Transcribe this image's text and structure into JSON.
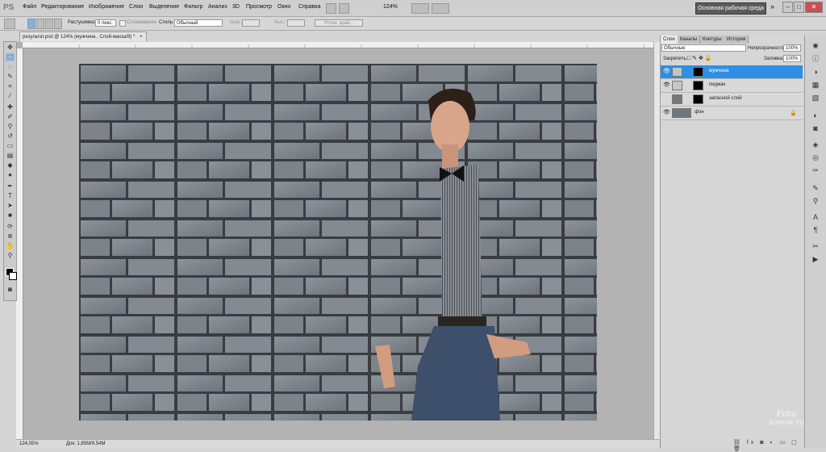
{
  "app": {
    "logo": "PS"
  },
  "menu": [
    "Файл",
    "Редактирование",
    "Изображение",
    "Слои",
    "Выделение",
    "Фильтр",
    "Анализ",
    "3D",
    "Просмотр",
    "Окно",
    "Справка"
  ],
  "zoom_menu": "124%",
  "workspace": "Основная рабочая среда",
  "window_controls": {
    "more": "»",
    "min": "–",
    "max": "□",
    "close": "✕"
  },
  "options": {
    "feather_label": "Растушевка:",
    "feather_value": "0 пикс.",
    "antialias_label": "Сглаживание",
    "style_label": "Стиль:",
    "style_value": "Обычный",
    "width_label": "Шир.:",
    "height_label": "Выс.:",
    "refine_edge": "Уточн. край..."
  },
  "document": {
    "tab_title": "результат.psd @ 124% (мужчина , Слой-маска/8) *",
    "close": "×",
    "status_zoom": "124,05%",
    "status_doc": "Док: 1,85M/9,54M"
  },
  "panel": {
    "tabs": [
      "Слои",
      "Каналы",
      "Контуры",
      "История"
    ],
    "blend_mode": "Обычные",
    "opacity_label": "Непрозрачность:",
    "opacity_value": "100%",
    "lock_label": "Закрепить:",
    "fill_label": "Заливка:",
    "fill_value": "100%",
    "layers": [
      {
        "name": "мужчина",
        "selected": true
      },
      {
        "name": "пиджак",
        "selected": false
      },
      {
        "name": "запасной слой",
        "selected": false
      },
      {
        "name": "фон",
        "selected": false
      }
    ]
  },
  "watermark": {
    "line1": "Foto",
    "line2": "komok.ru"
  },
  "icons": {
    "eye": "eye-icon",
    "lock": "lock-icon"
  }
}
